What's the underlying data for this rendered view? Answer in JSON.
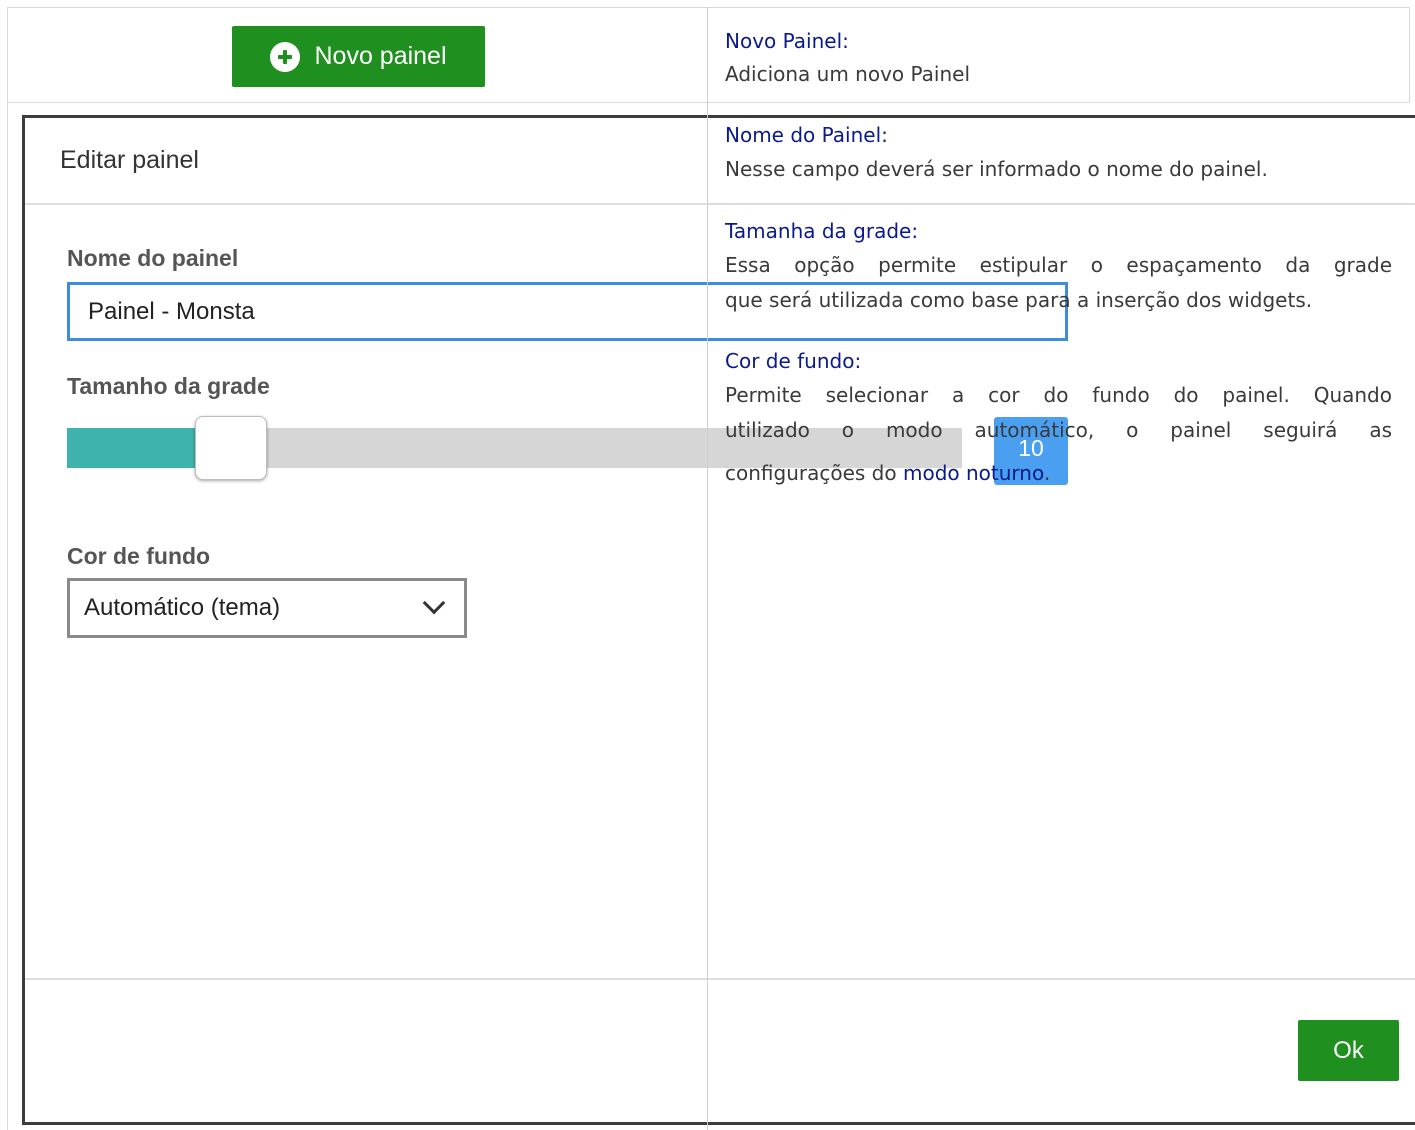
{
  "row1": {
    "button_label": "Novo painel",
    "icon": "plus-circle-icon",
    "title": "Novo Painel:",
    "text": "Adiciona um novo Painel"
  },
  "dialog": {
    "title": "Editar painel",
    "name_label": "Nome do painel",
    "name_value": "Painel - Monsta",
    "grid_label": "Tamanho da grade",
    "grid_value": "10",
    "bg_label": "Cor de fundo",
    "bg_selected": "Automático (tema)",
    "ok_label": "Ok",
    "colors": {
      "button_green": "#1f8f1f",
      "slider_fill": "#3eb3ab",
      "slider_badge": "#4a9ff0",
      "input_focus_border": "#3c8dde"
    }
  },
  "descriptions": {
    "name_title": "Nome do Painel:",
    "name_text": "Nesse campo deverá ser informado o nome do painel.",
    "grid_title": "Tamanha da grade:",
    "grid_text_line1": "Essa opção permite estipular o espaçamento da grade",
    "grid_text_line2": "que será utilizada como base para a inserção dos widgets.",
    "bg_title": "Cor de fundo:",
    "bg_text_line1": "Permite selecionar a cor do fundo do painel. Quando",
    "bg_text_line2": "utilizado o modo automático, o painel seguirá as",
    "bg_text_line3_start": "configurações do ",
    "bg_text_link": "modo noturno",
    "bg_text_line3_end": "."
  }
}
